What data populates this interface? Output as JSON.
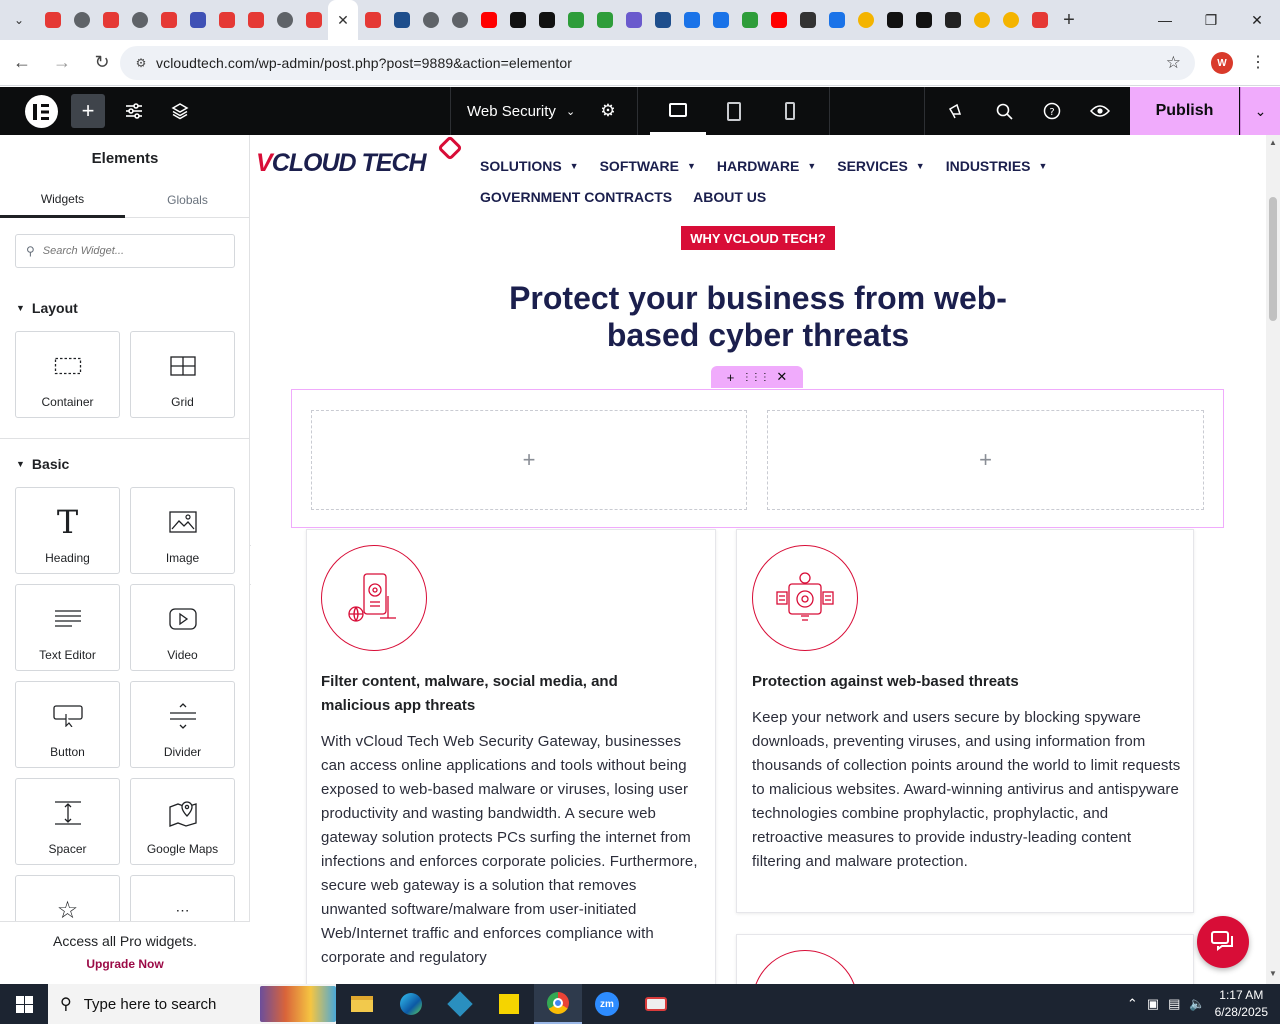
{
  "browser": {
    "tabs": [
      {
        "icon": "red-gem-favicon",
        "color": "#e53935"
      },
      {
        "icon": "globe-favicon",
        "color": "#5f6368"
      },
      {
        "icon": "red-gem-favicon",
        "color": "#e53935"
      },
      {
        "icon": "globe-favicon",
        "color": "#5f6368"
      },
      {
        "icon": "red-gem-favicon",
        "color": "#e53935"
      },
      {
        "icon": "blue-bird-favicon",
        "color": "#3f51b5"
      },
      {
        "icon": "red-gem-favicon",
        "color": "#e53935"
      },
      {
        "icon": "red-gem-favicon",
        "color": "#e53935"
      },
      {
        "icon": "globe-favicon",
        "color": "#5f6368"
      },
      {
        "icon": "red-gem-favicon",
        "color": "#e53935"
      },
      {
        "icon": "active-tab-close",
        "color": "#ffffff"
      },
      {
        "icon": "red-gem-favicon",
        "color": "#e53935"
      },
      {
        "icon": "web-favicon",
        "color": "#1e4e8c"
      },
      {
        "icon": "globe-favicon",
        "color": "#5f6368"
      },
      {
        "icon": "globe-favicon",
        "color": "#5f6368"
      },
      {
        "icon": "youtube-favicon",
        "color": "#ff0000"
      },
      {
        "icon": "openai-favicon",
        "color": "#111111"
      },
      {
        "icon": "openai-favicon",
        "color": "#111111"
      },
      {
        "icon": "green-bolt-favicon",
        "color": "#2e9d3a"
      },
      {
        "icon": "green-bolt-favicon",
        "color": "#2e9d3a"
      },
      {
        "icon": "purple-swirl-favicon",
        "color": "#6a5acd"
      },
      {
        "icon": "web-favicon",
        "color": "#1e4e8c"
      },
      {
        "icon": "blue-grid-favicon",
        "color": "#1a73e8"
      },
      {
        "icon": "blue-grid-favicon",
        "color": "#1a73e8"
      },
      {
        "icon": "green-bolt-favicon",
        "color": "#2e9d3a"
      },
      {
        "icon": "youtube-favicon",
        "color": "#ff0000"
      },
      {
        "icon": "lock-favicon",
        "color": "#333333"
      },
      {
        "icon": "arc-favicon",
        "color": "#1a73e8"
      },
      {
        "icon": "ring-favicon",
        "color": "#f4b400"
      },
      {
        "icon": "x-favicon",
        "color": "#111111"
      },
      {
        "icon": "x-favicon",
        "color": "#111111"
      },
      {
        "icon": "dark-square-favicon",
        "color": "#222222"
      },
      {
        "icon": "ring-favicon",
        "color": "#f4b400"
      },
      {
        "icon": "ring-favicon",
        "color": "#f4b400"
      },
      {
        "icon": "red-stroke-favicon",
        "color": "#e53935"
      }
    ],
    "url": "vcloudtech.com/wp-admin/post.php?post=9889&action=elementor",
    "profile_initial": "W"
  },
  "editor": {
    "document_name": "Web Security",
    "publish_label": "Publish",
    "panel": {
      "title": "Elements",
      "tabs": [
        "Widgets",
        "Globals"
      ],
      "search_placeholder": "Search Widget...",
      "categories": {
        "layout": {
          "label": "Layout",
          "widgets": [
            "Container",
            "Grid"
          ]
        },
        "basic": {
          "label": "Basic",
          "widgets": [
            "Heading",
            "Image",
            "Text Editor",
            "Video",
            "Button",
            "Divider",
            "Spacer",
            "Google Maps"
          ]
        }
      },
      "pro_text": "Access all Pro widgets.",
      "upgrade_label": "Upgrade Now"
    }
  },
  "page": {
    "brand": {
      "prefix": "V",
      "name": "CLOUD TECH"
    },
    "menu": [
      "SOLUTIONS",
      "SOFTWARE",
      "HARDWARE",
      "SERVICES",
      "INDUSTRIES"
    ],
    "menu2": [
      "GOVERNMENT CONTRACTS",
      "ABOUT US"
    ],
    "badge": "WHY VCLOUD TECH?",
    "headline": "Protect your business from web-based cyber threats",
    "cards": [
      {
        "title": "Filter content, malware, social media, and malicious app threats",
        "text": "With vCloud Tech Web Security Gateway, businesses can access online applications and tools without being exposed to web-based malware or viruses, losing user productivity and wasting bandwidth. A secure web gateway solution protects PCs surfing the internet from infections and enforces corporate policies. Furthermore, secure web gateway is a solution that removes unwanted software/malware from user-initiated Web/Internet traffic and enforces compliance with corporate and regulatory"
      },
      {
        "title": "Protection against web-based threats",
        "text": "Keep your network and users secure by blocking spyware downloads, preventing viruses, and using information from thousands of collection points around the world to limit requests to malicious websites. Award-winning antivirus and antispyware technologies combine prophylactic, prophylactic, and retroactive measures to provide industry-leading content filtering and malware protection."
      }
    ]
  },
  "taskbar": {
    "search_placeholder": "Type here to search",
    "time": "1:17 AM",
    "date": "6/28/2025"
  }
}
